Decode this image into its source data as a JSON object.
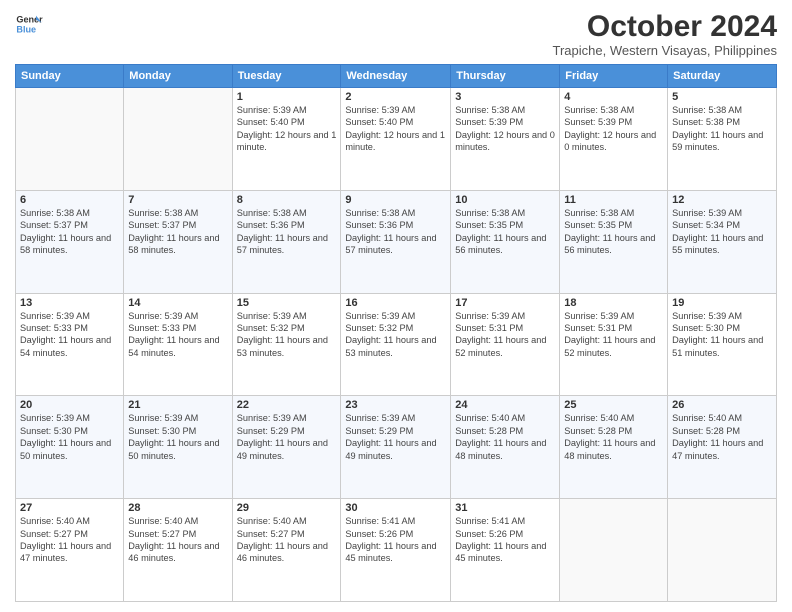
{
  "logo": {
    "line1": "General",
    "line2": "Blue"
  },
  "header": {
    "month": "October 2024",
    "location": "Trapiche, Western Visayas, Philippines"
  },
  "weekdays": [
    "Sunday",
    "Monday",
    "Tuesday",
    "Wednesday",
    "Thursday",
    "Friday",
    "Saturday"
  ],
  "weeks": [
    [
      {
        "day": "",
        "info": ""
      },
      {
        "day": "",
        "info": ""
      },
      {
        "day": "1",
        "info": "Sunrise: 5:39 AM\nSunset: 5:40 PM\nDaylight: 12 hours and 1 minute."
      },
      {
        "day": "2",
        "info": "Sunrise: 5:39 AM\nSunset: 5:40 PM\nDaylight: 12 hours and 1 minute."
      },
      {
        "day": "3",
        "info": "Sunrise: 5:38 AM\nSunset: 5:39 PM\nDaylight: 12 hours and 0 minutes."
      },
      {
        "day": "4",
        "info": "Sunrise: 5:38 AM\nSunset: 5:39 PM\nDaylight: 12 hours and 0 minutes."
      },
      {
        "day": "5",
        "info": "Sunrise: 5:38 AM\nSunset: 5:38 PM\nDaylight: 11 hours and 59 minutes."
      }
    ],
    [
      {
        "day": "6",
        "info": "Sunrise: 5:38 AM\nSunset: 5:37 PM\nDaylight: 11 hours and 58 minutes."
      },
      {
        "day": "7",
        "info": "Sunrise: 5:38 AM\nSunset: 5:37 PM\nDaylight: 11 hours and 58 minutes."
      },
      {
        "day": "8",
        "info": "Sunrise: 5:38 AM\nSunset: 5:36 PM\nDaylight: 11 hours and 57 minutes."
      },
      {
        "day": "9",
        "info": "Sunrise: 5:38 AM\nSunset: 5:36 PM\nDaylight: 11 hours and 57 minutes."
      },
      {
        "day": "10",
        "info": "Sunrise: 5:38 AM\nSunset: 5:35 PM\nDaylight: 11 hours and 56 minutes."
      },
      {
        "day": "11",
        "info": "Sunrise: 5:38 AM\nSunset: 5:35 PM\nDaylight: 11 hours and 56 minutes."
      },
      {
        "day": "12",
        "info": "Sunrise: 5:39 AM\nSunset: 5:34 PM\nDaylight: 11 hours and 55 minutes."
      }
    ],
    [
      {
        "day": "13",
        "info": "Sunrise: 5:39 AM\nSunset: 5:33 PM\nDaylight: 11 hours and 54 minutes."
      },
      {
        "day": "14",
        "info": "Sunrise: 5:39 AM\nSunset: 5:33 PM\nDaylight: 11 hours and 54 minutes."
      },
      {
        "day": "15",
        "info": "Sunrise: 5:39 AM\nSunset: 5:32 PM\nDaylight: 11 hours and 53 minutes."
      },
      {
        "day": "16",
        "info": "Sunrise: 5:39 AM\nSunset: 5:32 PM\nDaylight: 11 hours and 53 minutes."
      },
      {
        "day": "17",
        "info": "Sunrise: 5:39 AM\nSunset: 5:31 PM\nDaylight: 11 hours and 52 minutes."
      },
      {
        "day": "18",
        "info": "Sunrise: 5:39 AM\nSunset: 5:31 PM\nDaylight: 11 hours and 52 minutes."
      },
      {
        "day": "19",
        "info": "Sunrise: 5:39 AM\nSunset: 5:30 PM\nDaylight: 11 hours and 51 minutes."
      }
    ],
    [
      {
        "day": "20",
        "info": "Sunrise: 5:39 AM\nSunset: 5:30 PM\nDaylight: 11 hours and 50 minutes."
      },
      {
        "day": "21",
        "info": "Sunrise: 5:39 AM\nSunset: 5:30 PM\nDaylight: 11 hours and 50 minutes."
      },
      {
        "day": "22",
        "info": "Sunrise: 5:39 AM\nSunset: 5:29 PM\nDaylight: 11 hours and 49 minutes."
      },
      {
        "day": "23",
        "info": "Sunrise: 5:39 AM\nSunset: 5:29 PM\nDaylight: 11 hours and 49 minutes."
      },
      {
        "day": "24",
        "info": "Sunrise: 5:40 AM\nSunset: 5:28 PM\nDaylight: 11 hours and 48 minutes."
      },
      {
        "day": "25",
        "info": "Sunrise: 5:40 AM\nSunset: 5:28 PM\nDaylight: 11 hours and 48 minutes."
      },
      {
        "day": "26",
        "info": "Sunrise: 5:40 AM\nSunset: 5:28 PM\nDaylight: 11 hours and 47 minutes."
      }
    ],
    [
      {
        "day": "27",
        "info": "Sunrise: 5:40 AM\nSunset: 5:27 PM\nDaylight: 11 hours and 47 minutes."
      },
      {
        "day": "28",
        "info": "Sunrise: 5:40 AM\nSunset: 5:27 PM\nDaylight: 11 hours and 46 minutes."
      },
      {
        "day": "29",
        "info": "Sunrise: 5:40 AM\nSunset: 5:27 PM\nDaylight: 11 hours and 46 minutes."
      },
      {
        "day": "30",
        "info": "Sunrise: 5:41 AM\nSunset: 5:26 PM\nDaylight: 11 hours and 45 minutes."
      },
      {
        "day": "31",
        "info": "Sunrise: 5:41 AM\nSunset: 5:26 PM\nDaylight: 11 hours and 45 minutes."
      },
      {
        "day": "",
        "info": ""
      },
      {
        "day": "",
        "info": ""
      }
    ]
  ]
}
